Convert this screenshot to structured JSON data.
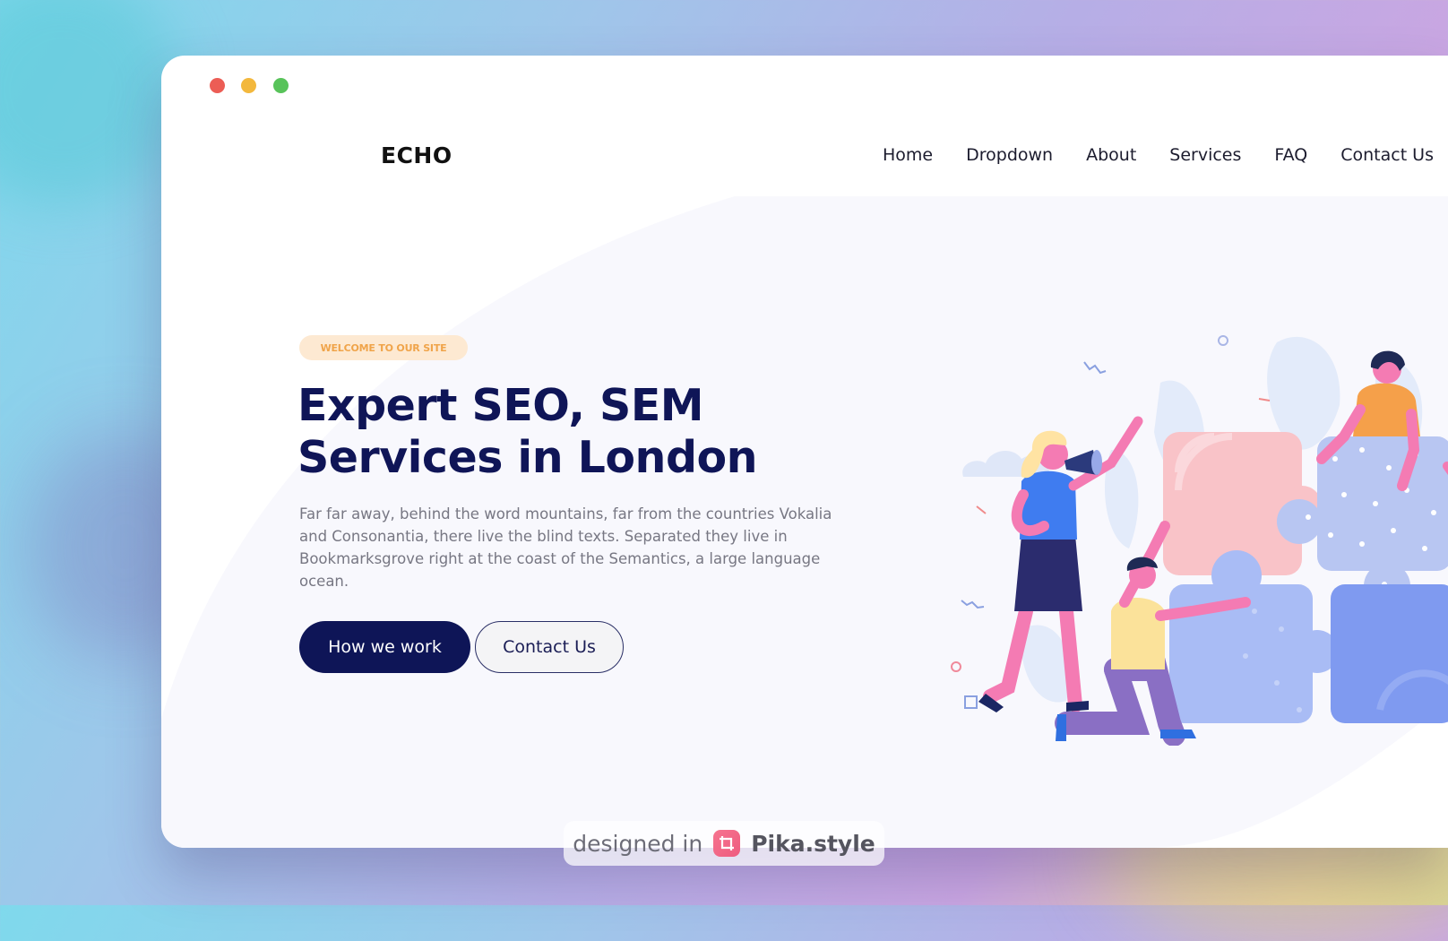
{
  "window": {
    "controls": [
      "close",
      "minimize",
      "maximize"
    ]
  },
  "header": {
    "logo": "ECHO",
    "nav": [
      {
        "label": "Home"
      },
      {
        "label": "Dropdown"
      },
      {
        "label": "About"
      },
      {
        "label": "Services"
      },
      {
        "label": "FAQ"
      },
      {
        "label": "Contact Us"
      }
    ]
  },
  "hero": {
    "badge": "WELCOME TO OUR SITE",
    "title_line1": "Expert SEO, SEM",
    "title_line2": "Services in London",
    "description": "Far far away, behind the word mountains, far from the countries Vokalia and Consonantia, there live the blind texts. Separated they live in Bookmarksgrove right at the coast of the Semantics, a large language ocean.",
    "primary_button": "How we work",
    "secondary_button": "Contact Us",
    "illustration_icon": "puzzle-team-illustration"
  },
  "watermark": {
    "prefix": "designed in",
    "brand": "Pika.style",
    "icon": "crop-icon"
  },
  "colors": {
    "primary": "#0e1557",
    "badge_bg": "#fde9d2",
    "badge_text": "#f0a44a",
    "close": "#ec5d55",
    "minimize": "#f3b83d",
    "maximize": "#58c35a"
  }
}
